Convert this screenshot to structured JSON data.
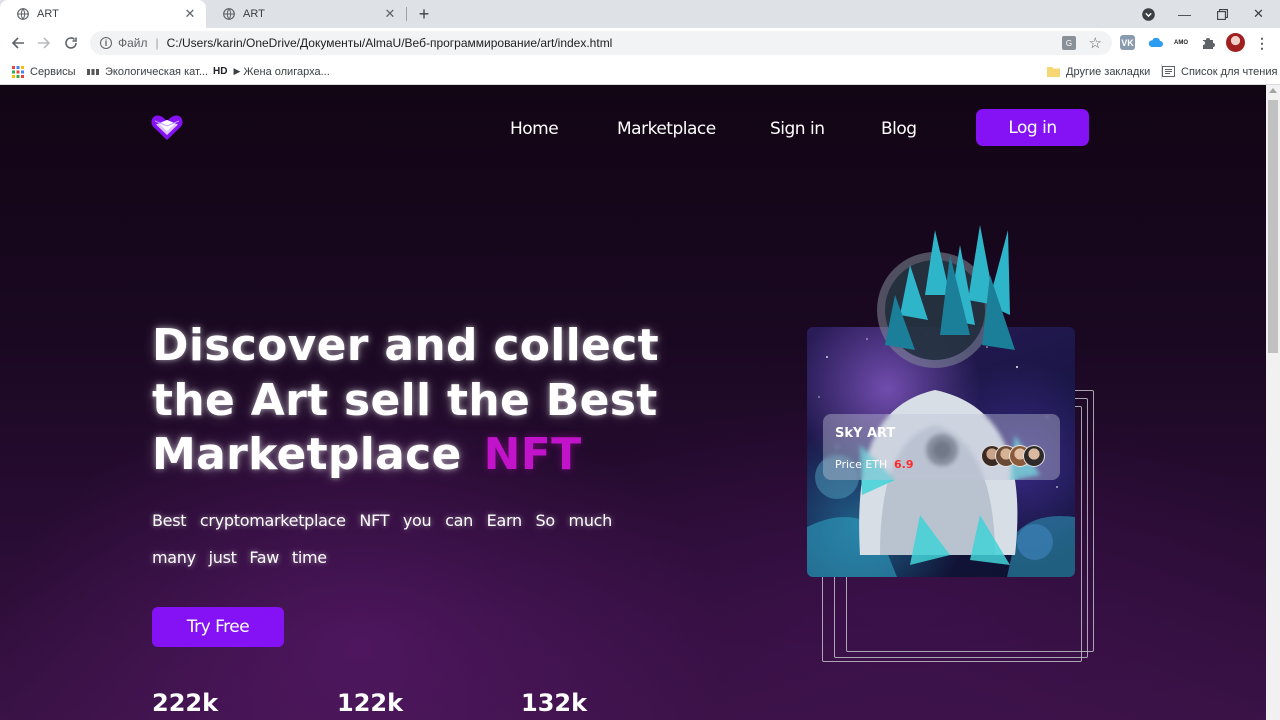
{
  "browser": {
    "tabs": [
      {
        "title": "ART",
        "active": true
      },
      {
        "title": "ART",
        "active": false
      }
    ],
    "address": {
      "scheme": "Файл",
      "url": "C:/Users/karin/OneDrive/Документы/AlmaU/Веб-программирование/art/index.html"
    },
    "extensions": {
      "amo_label": "AMO"
    },
    "bookmarks": {
      "items": [
        "Сервисы",
        "Экологическая кат...",
        "Жена олигарха..."
      ],
      "hd_label": "HD",
      "other": "Другие закладки",
      "reading_list": "Список для чтения"
    }
  },
  "page": {
    "nav": {
      "links": [
        "Home",
        "Marketplace",
        "Sign in",
        "Blog"
      ],
      "login": "Log in"
    },
    "hero": {
      "title_line1": "Discover and collect",
      "title_line2": "the Art sell the Best",
      "title_line3": "Marketplace",
      "title_highlight": "NFT",
      "subtitle": "Best cryptomarketplace NFT you can Earn So much many just Faw time",
      "cta": "Try Free"
    },
    "stats": [
      "222k",
      "122k",
      "132k"
    ],
    "card": {
      "title": "SkY ART",
      "price_label": "Price ETH",
      "price_value": "6.9"
    }
  },
  "colors": {
    "accent": "#8512f5",
    "highlight": "#c113c9",
    "price": "#ff2a2a"
  }
}
